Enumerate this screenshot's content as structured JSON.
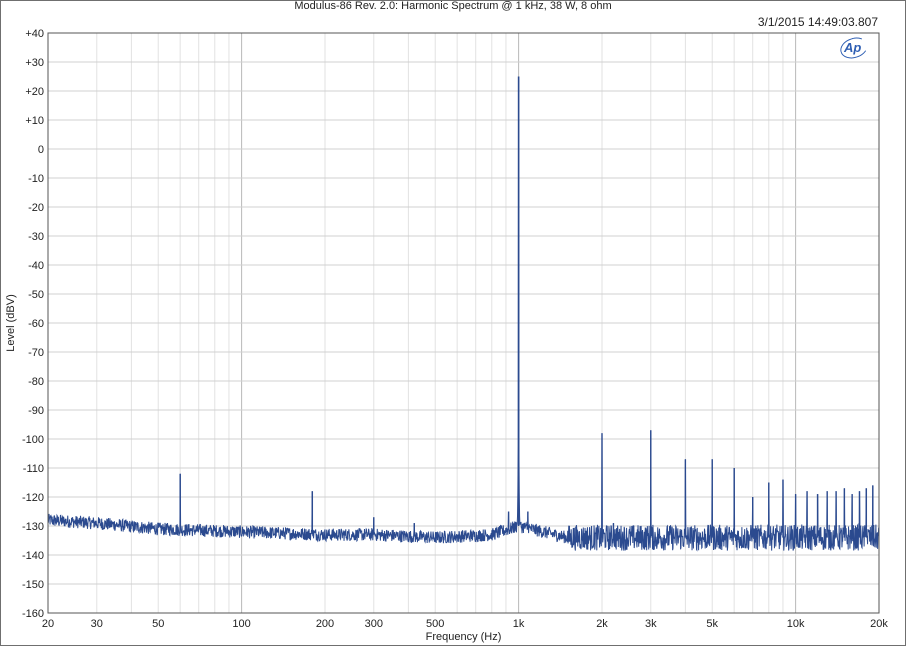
{
  "chart_data": {
    "type": "line",
    "title": "Modulus-86 Rev. 2.0: Harmonic Spectrum @ 1 kHz, 38 W, 8 ohm",
    "timestamp": "3/1/2015 14:49:03.807",
    "logo": "Ap",
    "xlabel": "Frequency (Hz)",
    "ylabel": "Level (dBV)",
    "xscale": "log",
    "xlim": [
      20,
      20000
    ],
    "ylim": [
      -160,
      40
    ],
    "grid": true,
    "x_ticks": [
      {
        "value": 20,
        "label": "20"
      },
      {
        "value": 30,
        "label": "30"
      },
      {
        "value": 50,
        "label": "50"
      },
      {
        "value": 100,
        "label": "100"
      },
      {
        "value": 200,
        "label": "200"
      },
      {
        "value": 300,
        "label": "300"
      },
      {
        "value": 500,
        "label": "500"
      },
      {
        "value": 1000,
        "label": "1k"
      },
      {
        "value": 2000,
        "label": "2k"
      },
      {
        "value": 3000,
        "label": "3k"
      },
      {
        "value": 5000,
        "label": "5k"
      },
      {
        "value": 10000,
        "label": "10k"
      },
      {
        "value": 20000,
        "label": "20k"
      }
    ],
    "y_ticks": [
      {
        "value": 40,
        "label": "+40"
      },
      {
        "value": 30,
        "label": "+30"
      },
      {
        "value": 20,
        "label": "+20"
      },
      {
        "value": 10,
        "label": "+10"
      },
      {
        "value": 0,
        "label": "0"
      },
      {
        "value": -10,
        "label": "-10"
      },
      {
        "value": -20,
        "label": "-20"
      },
      {
        "value": -30,
        "label": "-30"
      },
      {
        "value": -40,
        "label": "-40"
      },
      {
        "value": -50,
        "label": "-50"
      },
      {
        "value": -60,
        "label": "-60"
      },
      {
        "value": -70,
        "label": "-70"
      },
      {
        "value": -80,
        "label": "-80"
      },
      {
        "value": -90,
        "label": "-90"
      },
      {
        "value": -100,
        "label": "-100"
      },
      {
        "value": -110,
        "label": "-110"
      },
      {
        "value": -120,
        "label": "-120"
      },
      {
        "value": -130,
        "label": "-130"
      },
      {
        "value": -140,
        "label": "-140"
      },
      {
        "value": -150,
        "label": "-150"
      },
      {
        "value": -160,
        "label": "-160"
      }
    ],
    "series": [
      {
        "color": "#2b4a8f",
        "noise_floor": [
          [
            20,
            -128
          ],
          [
            30,
            -129
          ],
          [
            50,
            -131
          ],
          [
            100,
            -132
          ],
          [
            200,
            -133
          ],
          [
            300,
            -133
          ],
          [
            500,
            -134
          ],
          [
            800,
            -133
          ],
          [
            1000,
            -130
          ],
          [
            1500,
            -134
          ],
          [
            3000,
            -134
          ],
          [
            5000,
            -134
          ],
          [
            10000,
            -134
          ],
          [
            20000,
            -134
          ]
        ],
        "peaks": [
          {
            "x": 60,
            "y": -112
          },
          {
            "x": 180,
            "y": -118
          },
          {
            "x": 300,
            "y": -127
          },
          {
            "x": 420,
            "y": -129
          },
          {
            "x": 920,
            "y": -125
          },
          {
            "x": 1000,
            "y": 25
          },
          {
            "x": 1080,
            "y": -125
          },
          {
            "x": 2000,
            "y": -98
          },
          {
            "x": 2200,
            "y": -129
          },
          {
            "x": 3000,
            "y": -97
          },
          {
            "x": 4000,
            "y": -107
          },
          {
            "x": 5000,
            "y": -107
          },
          {
            "x": 6000,
            "y": -110
          },
          {
            "x": 7000,
            "y": -120
          },
          {
            "x": 8000,
            "y": -115
          },
          {
            "x": 9000,
            "y": -114
          },
          {
            "x": 10000,
            "y": -119
          },
          {
            "x": 11000,
            "y": -118
          },
          {
            "x": 12000,
            "y": -119
          },
          {
            "x": 13000,
            "y": -118
          },
          {
            "x": 14000,
            "y": -118
          },
          {
            "x": 15000,
            "y": -117
          },
          {
            "x": 16000,
            "y": -119
          },
          {
            "x": 17000,
            "y": -118
          },
          {
            "x": 18000,
            "y": -117
          },
          {
            "x": 19000,
            "y": -116
          }
        ]
      }
    ]
  }
}
